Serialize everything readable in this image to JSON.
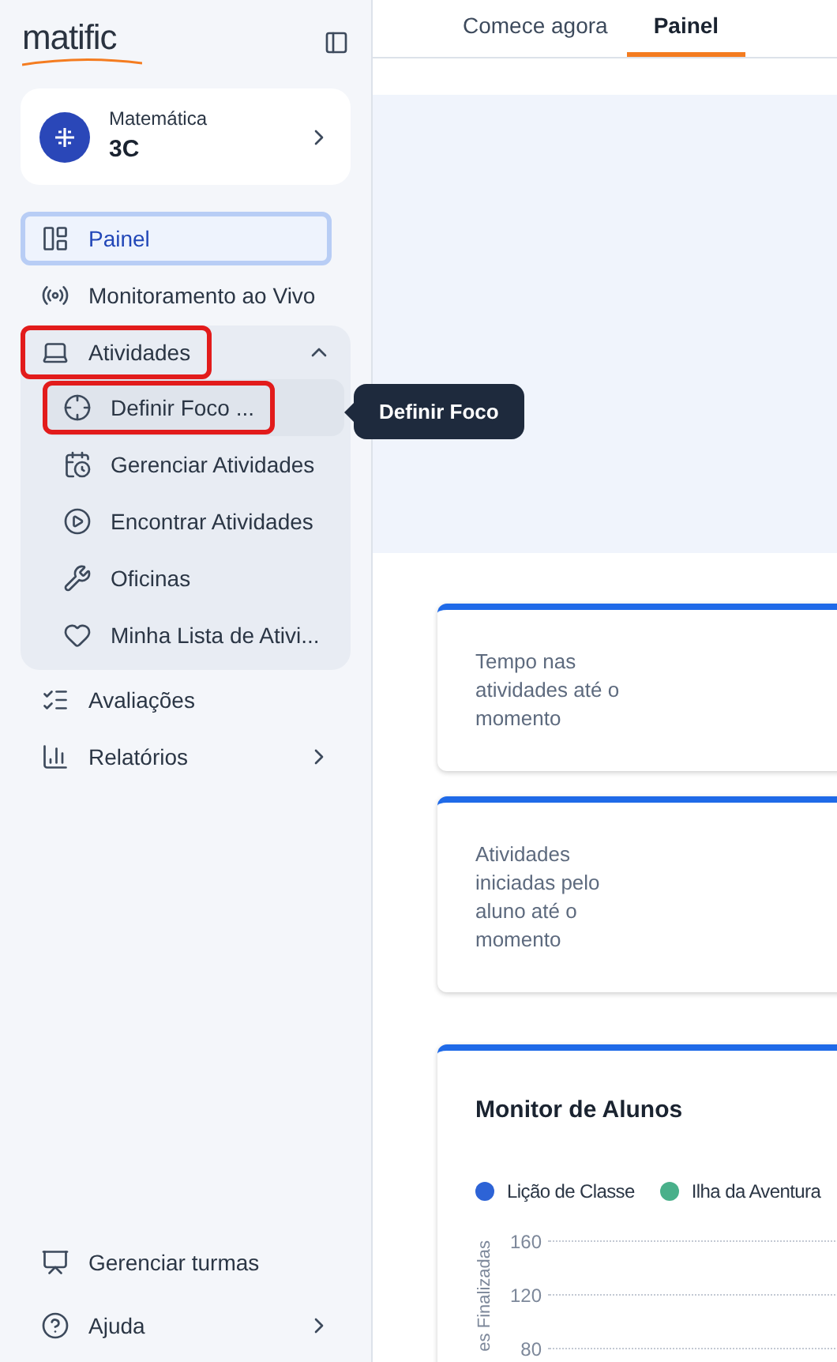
{
  "sidebar": {
    "logo": "matific",
    "class_card": {
      "subject": "Matemática",
      "class_name": "3C"
    },
    "nav": [
      {
        "kind": "item",
        "label": "Painel",
        "selected": true,
        "highlighted": false
      },
      {
        "kind": "item",
        "label": "Monitoramento ao Vivo",
        "selected": false,
        "highlighted": false
      },
      {
        "kind": "group",
        "label": "Atividades",
        "selected": false,
        "highlighted": true,
        "expanded": true,
        "children": [
          {
            "label": "Definir Foco ...",
            "selected": true,
            "highlighted": true
          },
          {
            "label": "Gerenciar Atividades",
            "selected": false,
            "highlighted": false
          },
          {
            "label": "Encontrar Atividades",
            "selected": false,
            "highlighted": false
          },
          {
            "label": "Oficinas",
            "selected": false,
            "highlighted": false
          },
          {
            "label": "Minha Lista de Ativi...",
            "selected": false,
            "highlighted": false
          }
        ]
      },
      {
        "kind": "item",
        "label": "Avaliações",
        "selected": false,
        "highlighted": false
      },
      {
        "kind": "submenu",
        "label": "Relatórios",
        "selected": false,
        "highlighted": false
      }
    ],
    "bottom": [
      {
        "kind": "item",
        "label": "Gerenciar turmas"
      },
      {
        "kind": "submenu",
        "label": "Ajuda"
      }
    ]
  },
  "tooltip": "Definir Foco",
  "tabs": [
    {
      "label": "Comece agora",
      "selected": false
    },
    {
      "label": "Painel",
      "selected": true
    }
  ],
  "stat_cards": [
    {
      "label": "Tempo nas atividades até o momento"
    },
    {
      "label": "Atividades iniciadas pelo aluno até o momento"
    }
  ],
  "student_monitor": {
    "title": "Monitor de Alunos",
    "legend": [
      {
        "label": "Lição de Classe",
        "color": "#2d63d6"
      },
      {
        "label": "Ilha da Aventura",
        "color": "#49b08a"
      }
    ],
    "y_axis_label": "es Finalizadas",
    "y_ticks": [
      "160",
      "120",
      "80"
    ]
  }
}
